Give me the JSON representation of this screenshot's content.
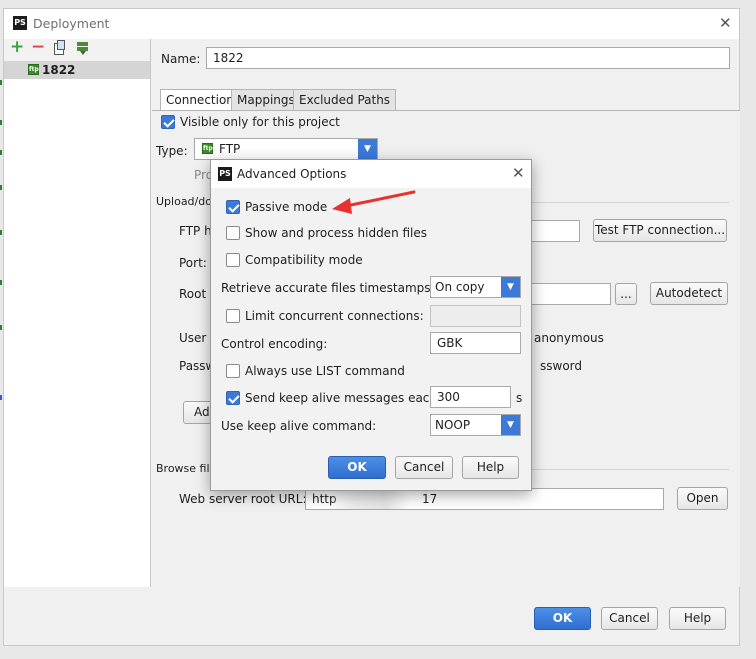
{
  "window": {
    "title": "Deployment",
    "logo_text": "PS"
  },
  "left_toolbar": {
    "add": "+",
    "remove": "−",
    "copy_icon": "copy-icon",
    "move_icon": "move-icon"
  },
  "tree": {
    "item_label": "1822",
    "item_icon": "ftp-server-icon"
  },
  "name_row": {
    "label": "Name:",
    "value": "1822"
  },
  "tabs": [
    {
      "label": "Connection",
      "active": true
    },
    {
      "label": "Mappings",
      "active": false
    },
    {
      "label": "Excluded Paths",
      "active": false
    }
  ],
  "connection": {
    "visible_only_label": "Visible only for this project",
    "visible_only_checked": true,
    "type_label": "Type:",
    "type_value": "FTP",
    "type_hint_partial": "Pro",
    "upload_section_partial": "Upload/dov",
    "ftp_host_label_partial": "FTP ho",
    "port_label_partial": "Port:",
    "root_label_partial": "Root p",
    "user_label_partial": "User n",
    "password_label_partial": "Passw",
    "anonymous_label_partial": "anonymous",
    "save_password_partial": "ssword",
    "advanced_button_partial": "Adv",
    "test_button": "Test FTP connection...",
    "browse_button": "...",
    "autodetect_button": "Autodetect",
    "browse_section_partial": "Browse files",
    "web_root_label": "Web server root URL:",
    "web_root_value_prefix": "http",
    "web_root_value_suffix": "17",
    "open_button": "Open"
  },
  "footer": {
    "ok": "OK",
    "cancel": "Cancel",
    "help": "Help"
  },
  "advanced_dialog": {
    "title": "Advanced Options",
    "logo_text": "PS",
    "passive_mode": {
      "label": "Passive mode",
      "checked": true
    },
    "hidden_files": {
      "label": "Show and process hidden files",
      "checked": false
    },
    "compat_mode": {
      "label": "Compatibility mode",
      "checked": false
    },
    "timestamps": {
      "label": "Retrieve accurate files timestamps:",
      "value": "On copy"
    },
    "limit_connections": {
      "label": "Limit concurrent connections:",
      "checked": false,
      "value": ""
    },
    "encoding": {
      "label": "Control encoding:",
      "value": "GBK"
    },
    "list_command": {
      "label": "Always use LIST command",
      "checked": false
    },
    "keep_alive": {
      "label": "Send keep alive messages each:",
      "checked": true,
      "value": "300",
      "unit": "s"
    },
    "keep_alive_cmd": {
      "label": "Use keep alive command:",
      "value": "NOOP"
    },
    "ok": "OK",
    "cancel": "Cancel",
    "help": "Help"
  },
  "colors": {
    "accent": "#3d7ad8",
    "annotation_arrow": "#e8322d",
    "add_green": "#3aa53a",
    "remove_red": "#d9473f"
  }
}
